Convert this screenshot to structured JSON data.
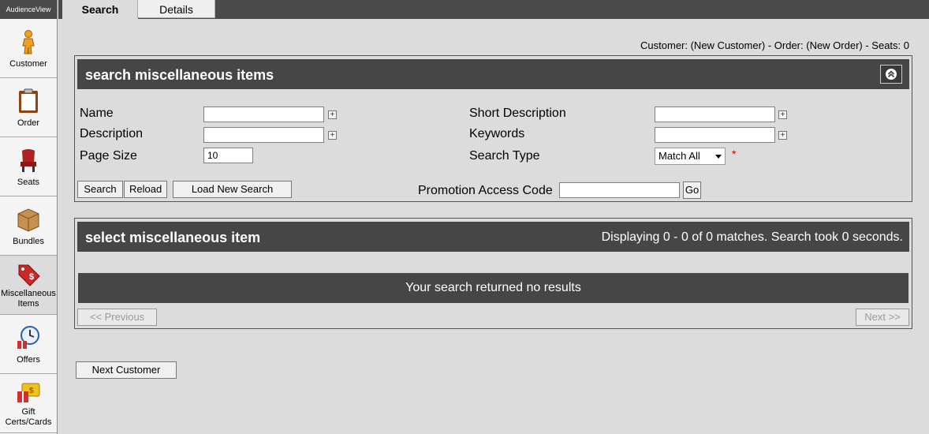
{
  "app": {
    "brand": "AudienceView"
  },
  "sidebar": {
    "items": [
      {
        "label": "Customer",
        "icon": "person-icon"
      },
      {
        "label": "Order",
        "icon": "clipboard-icon"
      },
      {
        "label": "Seats",
        "icon": "seat-icon"
      },
      {
        "label": "Bundles",
        "icon": "box-icon"
      },
      {
        "label": "Miscellaneous Items",
        "line1": "Miscellaneous",
        "line2": "Items",
        "icon": "price-tag-icon",
        "active": true
      },
      {
        "label": "Offers",
        "icon": "clock-gift-icon"
      },
      {
        "label": "Gift Certs/Cards",
        "line1": "Gift",
        "line2": "Certs/Cards",
        "icon": "gift-card-icon"
      }
    ]
  },
  "tabs": {
    "search": "Search",
    "details": "Details"
  },
  "status": "Customer: (New Customer) - Order: (New Order) - Seats: 0",
  "search_panel": {
    "title": "search miscellaneous items",
    "fields": {
      "name_label": "Name",
      "name_value": "",
      "description_label": "Description",
      "description_value": "",
      "page_size_label": "Page Size",
      "page_size_value": "10",
      "short_description_label": "Short Description",
      "short_description_value": "",
      "keywords_label": "Keywords",
      "keywords_value": "",
      "search_type_label": "Search Type",
      "search_type_value": "Match All",
      "required_marker": "*",
      "promo_label": "Promotion Access Code",
      "promo_value": ""
    },
    "buttons": {
      "search": "Search",
      "reload": "Reload",
      "load_new": "Load New Search",
      "go": "Go"
    }
  },
  "results_panel": {
    "title": "select miscellaneous item",
    "summary": "Displaying 0 - 0 of 0 matches. Search took 0 seconds.",
    "empty_message": "Your search returned no results",
    "prev": "<< Previous",
    "next": "Next >>"
  },
  "footer": {
    "next_customer": "Next Customer"
  },
  "colors": {
    "header_bg": "#464646",
    "page_bg": "#dcdcdc",
    "required": "#cc0000"
  }
}
